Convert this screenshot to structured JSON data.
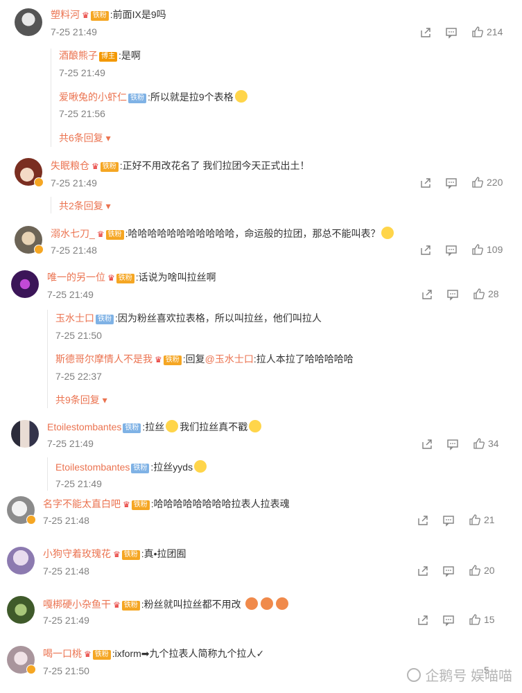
{
  "comments": [
    {
      "name": "塑料河",
      "badge": "铁粉",
      "text": ":前面IX是9吗",
      "time": "7-25 21:49",
      "share": "",
      "comment": "",
      "likes": "214"
    },
    {
      "name": "失眠粮仓",
      "badge": "铁粉",
      "text": ":正好不用改花名了 我们拉团今天正式出土！",
      "time": "7-25 21:49",
      "likes": "220"
    },
    {
      "name": "溺水七刀_",
      "badge": "铁粉",
      "text": ":哈哈哈哈哈哈哈哈哈哈哈，命运般的拉团，那总不能叫表？",
      "time": "7-25 21:48",
      "likes": "109"
    },
    {
      "name": "唯一的另一位",
      "badge": "铁粉",
      "text": ":话说为啥叫拉丝啊",
      "time": "7-25 21:49",
      "likes": "28"
    },
    {
      "name": "Etoilestombantes",
      "badge": "铁粉",
      "text": ":拉丝",
      "text2": "我们拉丝真不戳",
      "time": "7-25 21:49",
      "likes": "34"
    },
    {
      "name": "名字不能太直白吧",
      "badge": "铁粉",
      "text": ":哈哈哈哈哈哈哈哈拉表人拉表魂",
      "time": "7-25 21:48",
      "likes": "21"
    },
    {
      "name": "小狗守着玫瑰花",
      "badge": "铁粉",
      "text": ":真•拉团囿",
      "time": "7-25 21:48",
      "likes": "20"
    },
    {
      "name": "嘎梆硬小杂鱼干",
      "badge": "铁粉",
      "text": ":粉丝就叫拉丝都不用改",
      "time": "7-25 21:49",
      "likes": "15"
    },
    {
      "name": "喝一口桃",
      "badge": "铁粉",
      "text": ":ixform➡九个拉表人简称九个拉人✓",
      "time": "7-25 21:50",
      "likes": "5"
    }
  ],
  "replies": [
    {
      "name": "酒酿熊子",
      "badge": "博主",
      "text": ":是啊",
      "time": "7-25 21:49"
    },
    {
      "name": "爱啾兔的小虾仁",
      "badge": "铁粉",
      "text": ":所以就是拉9个表格",
      "time": "7-25 21:56"
    },
    {
      "more": "共6条回复"
    },
    {
      "more": "共2条回复"
    },
    {
      "name": "玉水士口",
      "badge": "铁粉",
      "text": ":因为粉丝喜欢拉表格，所以叫拉丝，他们叫拉人",
      "time": "7-25 21:50"
    },
    {
      "name": "斯德哥尔摩情人不是我",
      "badge": "铁粉",
      "text": ":回复",
      "mention": "@玉水士口",
      "text2": ":拉人本拉了哈哈哈哈哈",
      "time": "7-25 22:37"
    },
    {
      "more": "共9条回复"
    },
    {
      "name": "Etoilestombantes",
      "badge": "铁粉",
      "text": ":拉丝yyds",
      "time": "7-25 21:49"
    }
  ],
  "watermark": "企鹅号 娱喵喵"
}
